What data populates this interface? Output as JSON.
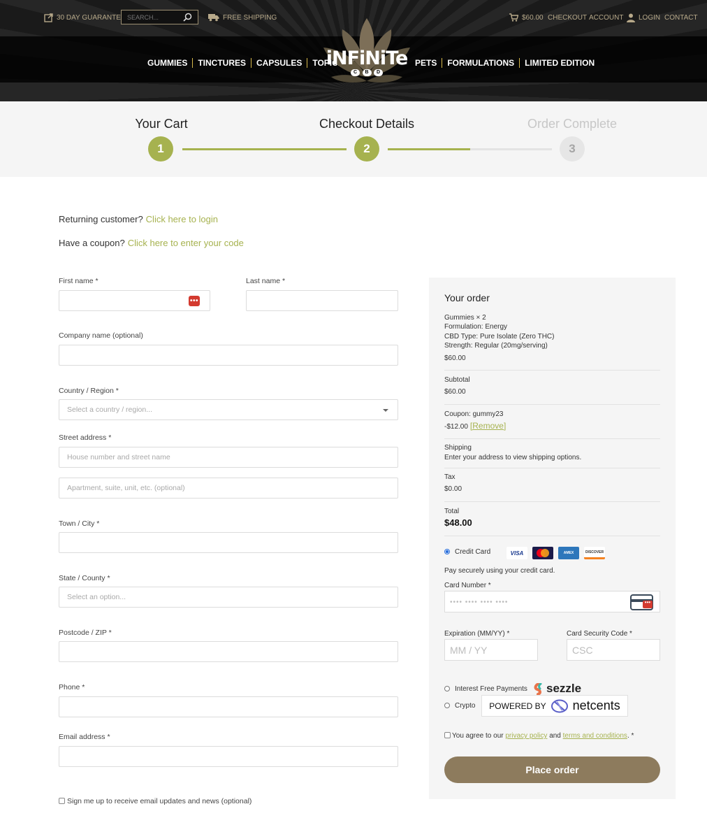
{
  "header": {
    "guarantee": "30 DAY GUARANTEE",
    "search_placeholder": "SEARCH...",
    "shipping": "FREE SHIPPING",
    "cart_amount": "$60.00",
    "checkout": "CHECKOUT",
    "account": "ACCOUNT",
    "login": "LOGIN",
    "contact": "CONTACT",
    "logo_main": "iNFiNiTe",
    "logo_sub": [
      "C",
      "B",
      "D"
    ],
    "nav_left": [
      "GUMMIES",
      "TINCTURES",
      "CAPSULES",
      "TOPICALS"
    ],
    "nav_right": [
      "PETS",
      "FORMULATIONS",
      "LIMITED EDITION"
    ],
    "accent_color": "#d6b84a"
  },
  "steps": [
    {
      "title": "Your Cart",
      "number": "1",
      "state": "done"
    },
    {
      "title": "Checkout Details",
      "number": "2",
      "state": "current"
    },
    {
      "title": "Order Complete",
      "number": "3",
      "state": "pending"
    }
  ],
  "notices": {
    "returning_text": "Returning customer?",
    "returning_link": "Click here to login",
    "coupon_text": "Have a coupon?",
    "coupon_link": "Click here to enter your code"
  },
  "form": {
    "first_name": "First name *",
    "last_name": "Last name *",
    "company": "Company name (optional)",
    "country": "Country / Region *",
    "country_placeholder": "Select a country / region...",
    "street": "Street address *",
    "street_placeholder": "House number and street name",
    "street2_placeholder": "Apartment, suite, unit, etc. (optional)",
    "city": "Town / City *",
    "state": "State / County *",
    "state_placeholder": "Select an option...",
    "zip": "Postcode / ZIP *",
    "phone": "Phone *",
    "email": "Email address *",
    "newsletter": "Sign me up to receive email updates and news (optional)"
  },
  "order": {
    "title": "Your order",
    "item_name": "Gummies  × 2",
    "item_formulation": "Formulation:  Energy",
    "item_cbd": "CBD Type:  Pure Isolate (Zero THC)",
    "item_strength": "Strength:  Regular (20mg/serving)",
    "item_price": "$60.00",
    "subtotal_label": "Subtotal",
    "subtotal_value": "$60.00",
    "coupon_label": "Coupon: gummy23",
    "coupon_value": "-$12.00",
    "coupon_remove": "[Remove]",
    "shipping_label": "Shipping",
    "shipping_value": "Enter your address to view shipping options.",
    "tax_label": "Tax",
    "tax_value": "$0.00",
    "total_label": "Total",
    "total_value": "$48.00",
    "payment_cc": "Credit Card",
    "cards": [
      "VISA",
      "MC",
      "AMEX",
      "DISCOVER"
    ],
    "pay_desc": "Pay securely using your credit card.",
    "card_number_label": "Card Number *",
    "card_number_placeholder": "•••• •••• •••• ••••",
    "expiry_label": "Expiration (MM/YY) *",
    "expiry_placeholder": "MM / YY",
    "csc_label": "Card Security Code *",
    "csc_placeholder": "CSC",
    "payment_sezzle": "Interest Free Payments",
    "sezzle_brand": "sezzle",
    "payment_crypto": "Crypto",
    "netcents_powered": "POWERED BY",
    "netcents_brand": "netcents",
    "terms_prefix": "You agree to our",
    "terms_privacy": "privacy policy",
    "terms_and": "and",
    "terms_link": "terms and conditions",
    "terms_suffix": ". *",
    "place_order": "Place order"
  }
}
